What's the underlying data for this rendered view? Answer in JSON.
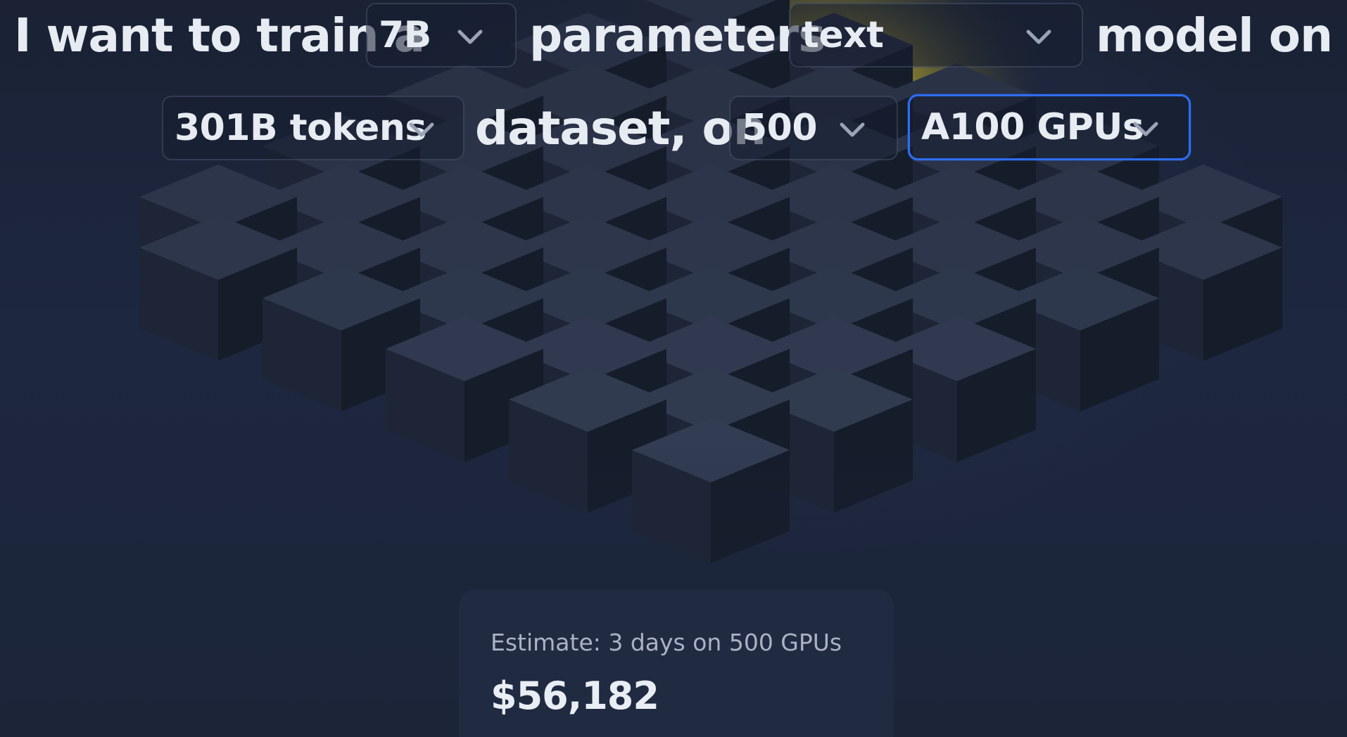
{
  "sentence": {
    "part1": "I want to train a",
    "part2": "parameters",
    "part3": "model on a",
    "part4": "dataset, on"
  },
  "selects": {
    "model_size": "7B",
    "modality": "text",
    "dataset_size": "301B tokens",
    "gpu_count": "500",
    "gpu_type": "A100 GPUs"
  },
  "estimate": {
    "summary": "Estimate: 3 days on 500 GPUs",
    "cost": "$56,182"
  },
  "icons": {
    "dropdown": "chevron-down-icon"
  },
  "colors": {
    "focus_border": "#2f6df2",
    "glow": "#d8c33a",
    "background": "#1c2538"
  }
}
